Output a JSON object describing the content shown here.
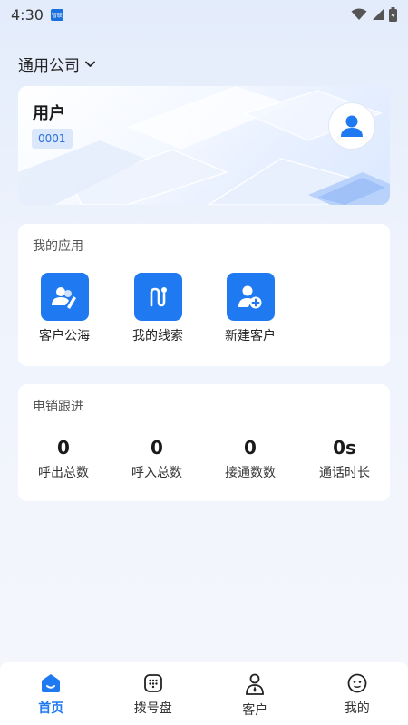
{
  "status_bar": {
    "time": "4:30",
    "app_badge": "智联",
    "icons": [
      "wifi-icon",
      "signal-icon",
      "battery-icon"
    ]
  },
  "header": {
    "company": "通用公司",
    "dropdown_icon": "chevron-down-icon"
  },
  "user_card": {
    "name": "用户",
    "id": "0001",
    "avatar_icon": "user-avatar-icon"
  },
  "apps": {
    "title": "我的应用",
    "items": [
      {
        "label": "客户公海",
        "icon": "customer-pool-icon"
      },
      {
        "label": "我的线索",
        "icon": "leads-icon"
      },
      {
        "label": "新建客户",
        "icon": "add-customer-icon"
      }
    ]
  },
  "stats": {
    "title": "电销跟进",
    "items": [
      {
        "value": "0",
        "label": "呼出总数"
      },
      {
        "value": "0",
        "label": "呼入总数"
      },
      {
        "value": "0",
        "label": "接通数数"
      },
      {
        "value": "0s",
        "label": "通话时长"
      }
    ]
  },
  "tab_bar": {
    "items": [
      {
        "label": "首页",
        "icon": "home-icon",
        "active": true
      },
      {
        "label": "拨号盘",
        "icon": "dialpad-icon",
        "active": false
      },
      {
        "label": "客户",
        "icon": "customer-icon",
        "active": false
      },
      {
        "label": "我的",
        "icon": "profile-icon",
        "active": false
      }
    ]
  },
  "colors": {
    "accent": "#1f7af2",
    "badge_bg": "#dbe7fb",
    "badge_text": "#2a6fdc"
  }
}
